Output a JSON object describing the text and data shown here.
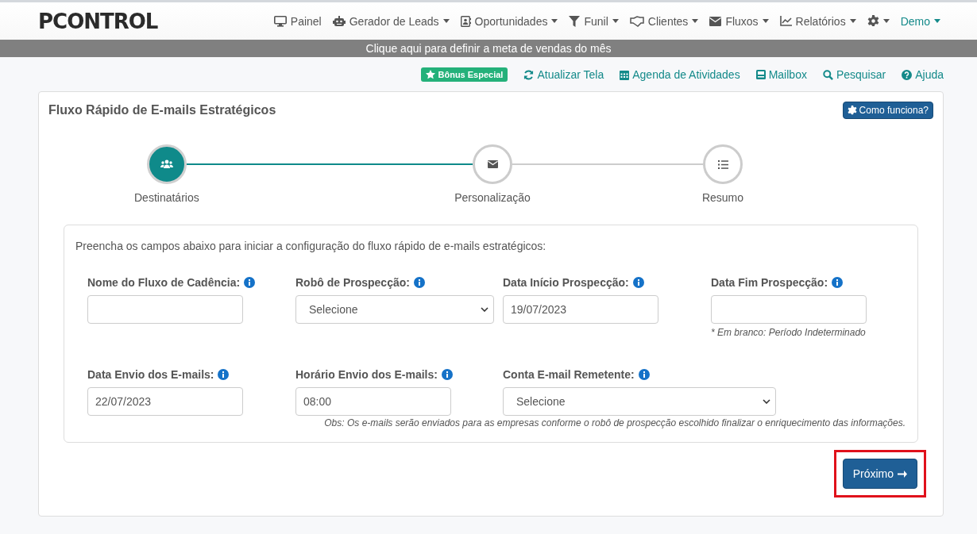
{
  "logo": "PCONTROL",
  "nav": [
    {
      "label": "Painel",
      "dropdown": false
    },
    {
      "label": "Gerador de Leads",
      "dropdown": true
    },
    {
      "label": "Oportunidades",
      "dropdown": true
    },
    {
      "label": "Funil",
      "dropdown": true
    },
    {
      "label": "Clientes",
      "dropdown": true
    },
    {
      "label": "Fluxos",
      "dropdown": true
    },
    {
      "label": "Relatórios",
      "dropdown": true
    },
    {
      "dropdown": true,
      "kind": "settings"
    },
    {
      "label": "Demo",
      "dropdown": true,
      "kind": "user"
    }
  ],
  "banner": "Clique aqui para definir a meta de vendas do mês",
  "quick_links": [
    {
      "label": "Bônus Especial",
      "kind": "badge"
    },
    {
      "label": "Atualizar Tela",
      "kind": "link"
    },
    {
      "label": "Agenda de Atividades",
      "kind": "link"
    },
    {
      "label": "Mailbox",
      "kind": "link"
    },
    {
      "label": "Pesquisar",
      "kind": "link"
    },
    {
      "label": "Ajuda",
      "kind": "link"
    }
  ],
  "card": {
    "title": "Fluxo Rápido de E-mails Estratégicos",
    "help_button": "Como funciona?",
    "steps": [
      {
        "label": "Destinatários",
        "selected": true
      },
      {
        "label": "Personalização",
        "selected": false
      },
      {
        "label": "Resumo",
        "selected": false
      }
    ],
    "intro": "Preencha os campos abaixo para iniciar a configuração do fluxo rápido de e-mails estratégicos:",
    "rows": [
      [
        {
          "label": "Nome do Fluxo de Cadência:",
          "kind": "text"
        },
        {
          "label": "Robô de Prospecção:",
          "kind": "select",
          "value": "Selecione"
        },
        {
          "label": "Data Início Prospecção:",
          "kind": "text",
          "value": "19/07/2023"
        },
        {
          "label": "Data Fim Prospecção:",
          "kind": "text",
          "note": "* Em branco: Período Indeterminado"
        }
      ],
      [
        {
          "label": "Data Envio dos E-mails:",
          "kind": "text",
          "value": "22/07/2023"
        },
        {
          "label": "Horário Envio dos E-mails:",
          "kind": "text",
          "value": "08:00"
        },
        {
          "label": "Conta E-mail Remetente:",
          "kind": "select",
          "value": "Selecione"
        }
      ]
    ],
    "obs": "Obs: Os e-mails serão enviados para as empresas conforme o robô de prospecção escolhido finalizar o enriquecimento das informações.",
    "next_button": {
      "label": "Próximo",
      "highlighted": true
    }
  }
}
